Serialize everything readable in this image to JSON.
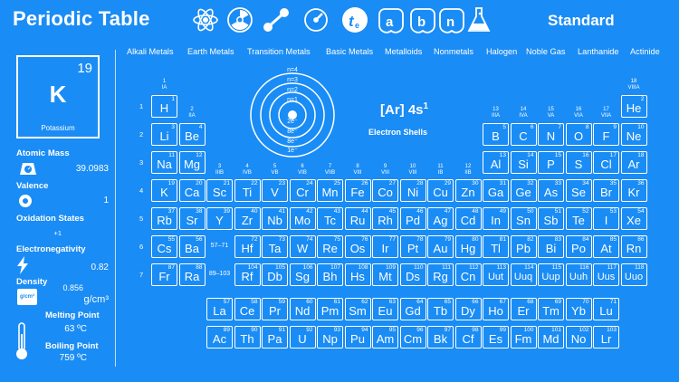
{
  "app_title": "Periodic Table",
  "mode_label": "Standard",
  "toolbar": {
    "icons": [
      "atom-icon",
      "radiation-icon",
      "molecule-icon",
      "gauge-icon",
      "electron-icon",
      "alpha-icon",
      "beta-icon",
      "neutron-icon",
      "flask-icon"
    ]
  },
  "categories": [
    "Alkali Metals",
    "Earth Metals",
    "Transition Metals",
    "Basic Metals",
    "Metalloids",
    "Nonmetals",
    "Halogen",
    "Noble Gas",
    "Lanthanide",
    "Actinide"
  ],
  "selected": {
    "number": "19",
    "symbol": "K",
    "name": "Potassium",
    "atomic_mass_label": "Atomic Mass",
    "atomic_mass": "39.0983",
    "valence_label": "Valence",
    "valence": "1",
    "oxidation_label": "Oxidation States",
    "oxidation": "+1",
    "electronegativity_label": "Electronegativity",
    "electronegativity": "0.82",
    "density_label": "Density",
    "density": "0.856",
    "density_unit": "g/cm³",
    "density_icon_text": "g/cm³",
    "melting_label": "Melting Point",
    "melting": "63 ºC",
    "boiling_label": "Boiling Point",
    "boiling": "759 ºC",
    "config": "[Ar] 4s",
    "config_sup": "1",
    "shells_label": "Electron Shells",
    "shell_labels": [
      "n=4",
      "n=3",
      "n=2",
      "n=1"
    ],
    "shell_electrons": [
      "2e⁻",
      "8e⁻",
      "8e⁻",
      "1e⁻"
    ]
  },
  "row_labels": [
    "1",
    "2",
    "3",
    "4",
    "5",
    "6",
    "7"
  ],
  "groups": [
    "1\nIA",
    "2\nIIA",
    "3\nIIIB",
    "4\nIVB",
    "5\nVB",
    "6\nVIB",
    "7\nVIIB",
    "8\nVIII",
    "9\nVIII",
    "10\nVIII",
    "11\nIB",
    "12\nIIB",
    "13\nIIIA",
    "14\nIVA",
    "15\nVA",
    "16\nVIA",
    "17\nVIIA",
    "18\nVIIIA"
  ],
  "elements": [
    {
      "n": "1",
      "s": "H"
    },
    {
      "n": "2",
      "s": "He"
    },
    {
      "n": "3",
      "s": "Li"
    },
    {
      "n": "4",
      "s": "Be"
    },
    {
      "n": "5",
      "s": "B"
    },
    {
      "n": "6",
      "s": "C"
    },
    {
      "n": "7",
      "s": "N"
    },
    {
      "n": "8",
      "s": "O"
    },
    {
      "n": "9",
      "s": "F"
    },
    {
      "n": "10",
      "s": "Ne"
    },
    {
      "n": "11",
      "s": "Na"
    },
    {
      "n": "12",
      "s": "Mg"
    },
    {
      "n": "13",
      "s": "Al"
    },
    {
      "n": "14",
      "s": "Si"
    },
    {
      "n": "15",
      "s": "P"
    },
    {
      "n": "16",
      "s": "S"
    },
    {
      "n": "17",
      "s": "Cl"
    },
    {
      "n": "18",
      "s": "Ar"
    },
    {
      "n": "19",
      "s": "K"
    },
    {
      "n": "20",
      "s": "Ca"
    },
    {
      "n": "21",
      "s": "Sc"
    },
    {
      "n": "22",
      "s": "Ti"
    },
    {
      "n": "23",
      "s": "V"
    },
    {
      "n": "24",
      "s": "Cr"
    },
    {
      "n": "25",
      "s": "Mn"
    },
    {
      "n": "26",
      "s": "Fe"
    },
    {
      "n": "27",
      "s": "Co"
    },
    {
      "n": "28",
      "s": "Ni"
    },
    {
      "n": "29",
      "s": "Cu"
    },
    {
      "n": "30",
      "s": "Zn"
    },
    {
      "n": "31",
      "s": "Ga"
    },
    {
      "n": "32",
      "s": "Ge"
    },
    {
      "n": "33",
      "s": "As"
    },
    {
      "n": "34",
      "s": "Se"
    },
    {
      "n": "35",
      "s": "Br"
    },
    {
      "n": "36",
      "s": "Kr"
    },
    {
      "n": "37",
      "s": "Rb"
    },
    {
      "n": "38",
      "s": "Sr"
    },
    {
      "n": "39",
      "s": "Y"
    },
    {
      "n": "40",
      "s": "Zr"
    },
    {
      "n": "41",
      "s": "Nb"
    },
    {
      "n": "42",
      "s": "Mo"
    },
    {
      "n": "43",
      "s": "Tc"
    },
    {
      "n": "44",
      "s": "Ru"
    },
    {
      "n": "45",
      "s": "Rh"
    },
    {
      "n": "46",
      "s": "Pd"
    },
    {
      "n": "47",
      "s": "Ag"
    },
    {
      "n": "48",
      "s": "Cd"
    },
    {
      "n": "49",
      "s": "In"
    },
    {
      "n": "50",
      "s": "Sn"
    },
    {
      "n": "51",
      "s": "Sb"
    },
    {
      "n": "52",
      "s": "Te"
    },
    {
      "n": "53",
      "s": "I"
    },
    {
      "n": "54",
      "s": "Xe"
    },
    {
      "n": "55",
      "s": "Cs"
    },
    {
      "n": "56",
      "s": "Ba"
    },
    {
      "n": "",
      "s": "57–71"
    },
    {
      "n": "72",
      "s": "Hf"
    },
    {
      "n": "73",
      "s": "Ta"
    },
    {
      "n": "74",
      "s": "W"
    },
    {
      "n": "75",
      "s": "Re"
    },
    {
      "n": "76",
      "s": "Os"
    },
    {
      "n": "77",
      "s": "Ir"
    },
    {
      "n": "78",
      "s": "Pt"
    },
    {
      "n": "79",
      "s": "Au"
    },
    {
      "n": "80",
      "s": "Hg"
    },
    {
      "n": "81",
      "s": "Tl"
    },
    {
      "n": "82",
      "s": "Pb"
    },
    {
      "n": "83",
      "s": "Bi"
    },
    {
      "n": "84",
      "s": "Po"
    },
    {
      "n": "85",
      "s": "At"
    },
    {
      "n": "86",
      "s": "Rn"
    },
    {
      "n": "87",
      "s": "Fr"
    },
    {
      "n": "88",
      "s": "Ra"
    },
    {
      "n": "",
      "s": "89–103"
    },
    {
      "n": "104",
      "s": "Rf"
    },
    {
      "n": "105",
      "s": "Db"
    },
    {
      "n": "106",
      "s": "Sg"
    },
    {
      "n": "107",
      "s": "Bh"
    },
    {
      "n": "108",
      "s": "Hs"
    },
    {
      "n": "109",
      "s": "Mt"
    },
    {
      "n": "110",
      "s": "Ds"
    },
    {
      "n": "111",
      "s": "Rg"
    },
    {
      "n": "112",
      "s": "Cn"
    },
    {
      "n": "113",
      "s": "Uut"
    },
    {
      "n": "114",
      "s": "Uuq"
    },
    {
      "n": "115",
      "s": "Uup"
    },
    {
      "n": "116",
      "s": "Uuh"
    },
    {
      "n": "117",
      "s": "Uus"
    },
    {
      "n": "118",
      "s": "Uuo"
    },
    {
      "n": "57",
      "s": "La"
    },
    {
      "n": "58",
      "s": "Ce"
    },
    {
      "n": "59",
      "s": "Pr"
    },
    {
      "n": "60",
      "s": "Nd"
    },
    {
      "n": "61",
      "s": "Pm"
    },
    {
      "n": "62",
      "s": "Sm"
    },
    {
      "n": "63",
      "s": "Eu"
    },
    {
      "n": "64",
      "s": "Gd"
    },
    {
      "n": "65",
      "s": "Tb"
    },
    {
      "n": "66",
      "s": "Dy"
    },
    {
      "n": "67",
      "s": "Ho"
    },
    {
      "n": "68",
      "s": "Er"
    },
    {
      "n": "69",
      "s": "Tm"
    },
    {
      "n": "70",
      "s": "Yb"
    },
    {
      "n": "71",
      "s": "Lu"
    },
    {
      "n": "89",
      "s": "Ac"
    },
    {
      "n": "90",
      "s": "Th"
    },
    {
      "n": "91",
      "s": "Pa"
    },
    {
      "n": "92",
      "s": "U"
    },
    {
      "n": "93",
      "s": "Np"
    },
    {
      "n": "94",
      "s": "Pu"
    },
    {
      "n": "95",
      "s": "Am"
    },
    {
      "n": "96",
      "s": "Cm"
    },
    {
      "n": "97",
      "s": "Bk"
    },
    {
      "n": "98",
      "s": "Cf"
    },
    {
      "n": "99",
      "s": "Es"
    },
    {
      "n": "100",
      "s": "Fm"
    },
    {
      "n": "101",
      "s": "Md"
    },
    {
      "n": "102",
      "s": "No"
    },
    {
      "n": "103",
      "s": "Lr"
    }
  ]
}
